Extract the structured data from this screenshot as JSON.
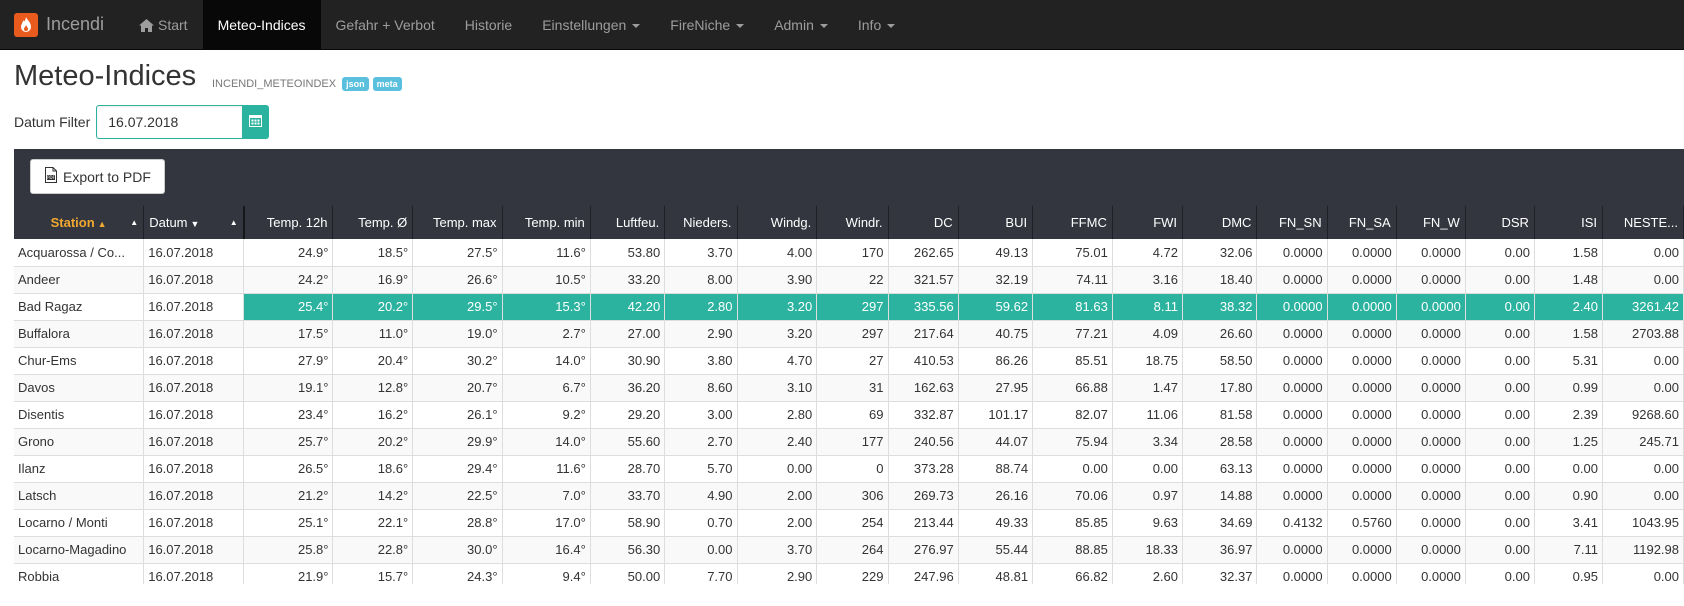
{
  "nav": {
    "brand": "Incendi",
    "items": [
      {
        "label": "Start",
        "active": false,
        "dropdown": false
      },
      {
        "label": "Meteo-Indices",
        "active": true,
        "dropdown": false
      },
      {
        "label": "Gefahr + Verbot",
        "active": false,
        "dropdown": false
      },
      {
        "label": "Historie",
        "active": false,
        "dropdown": false
      },
      {
        "label": "Einstellungen",
        "active": false,
        "dropdown": true
      },
      {
        "label": "FireNiche",
        "active": false,
        "dropdown": true
      },
      {
        "label": "Admin",
        "active": false,
        "dropdown": true
      },
      {
        "label": "Info",
        "active": false,
        "dropdown": true
      }
    ]
  },
  "page": {
    "title": "Meteo-Indices",
    "subtitle": "INCENDI_METEOINDEX",
    "badges": [
      "json",
      "meta"
    ]
  },
  "filter": {
    "label": "Datum Filter",
    "value": "16.07.2018"
  },
  "export_label": "Export to PDF",
  "colors": {
    "navbar": "#222222",
    "accent": "#2bb3a0",
    "header": "#33363e",
    "sort_active": "#f0a830",
    "badge": "#5bc0de"
  },
  "table": {
    "columns": [
      {
        "label": "Station",
        "sort": "▲"
      },
      {
        "label": "Datum",
        "sort": "▼"
      },
      {
        "label": "Temp. 12h"
      },
      {
        "label": "Temp. Ø"
      },
      {
        "label": "Temp. max"
      },
      {
        "label": "Temp. min"
      },
      {
        "label": "Luftfeu."
      },
      {
        "label": "Nieders."
      },
      {
        "label": "Windg."
      },
      {
        "label": "Windr."
      },
      {
        "label": "DC"
      },
      {
        "label": "BUI"
      },
      {
        "label": "FFMC"
      },
      {
        "label": "FWI"
      },
      {
        "label": "DMC"
      },
      {
        "label": "FN_SN"
      },
      {
        "label": "FN_SA"
      },
      {
        "label": "FN_W"
      },
      {
        "label": "DSR"
      },
      {
        "label": "ISI"
      },
      {
        "label": "NESTE..."
      }
    ],
    "highlight_row": 2,
    "rows": [
      [
        "Acquarossa / Co...",
        "16.07.2018",
        "24.9°",
        "18.5°",
        "27.5°",
        "11.6°",
        "53.80",
        "3.70",
        "4.00",
        "170",
        "262.65",
        "49.13",
        "75.01",
        "4.72",
        "32.06",
        "0.0000",
        "0.0000",
        "0.0000",
        "0.00",
        "1.58",
        "0.00"
      ],
      [
        "Andeer",
        "16.07.2018",
        "24.2°",
        "16.9°",
        "26.6°",
        "10.5°",
        "33.20",
        "8.00",
        "3.90",
        "22",
        "321.57",
        "32.19",
        "74.11",
        "3.16",
        "18.40",
        "0.0000",
        "0.0000",
        "0.0000",
        "0.00",
        "1.48",
        "0.00"
      ],
      [
        "Bad Ragaz",
        "16.07.2018",
        "25.4°",
        "20.2°",
        "29.5°",
        "15.3°",
        "42.20",
        "2.80",
        "3.20",
        "297",
        "335.56",
        "59.62",
        "81.63",
        "8.11",
        "38.32",
        "0.0000",
        "0.0000",
        "0.0000",
        "0.00",
        "2.40",
        "3261.42"
      ],
      [
        "Buffalora",
        "16.07.2018",
        "17.5°",
        "11.0°",
        "19.0°",
        "2.7°",
        "27.00",
        "2.90",
        "3.20",
        "297",
        "217.64",
        "40.75",
        "77.21",
        "4.09",
        "26.60",
        "0.0000",
        "0.0000",
        "0.0000",
        "0.00",
        "1.58",
        "2703.88"
      ],
      [
        "Chur-Ems",
        "16.07.2018",
        "27.9°",
        "20.4°",
        "30.2°",
        "14.0°",
        "30.90",
        "3.80",
        "4.70",
        "27",
        "410.53",
        "86.26",
        "85.51",
        "18.75",
        "58.50",
        "0.0000",
        "0.0000",
        "0.0000",
        "0.00",
        "5.31",
        "0.00"
      ],
      [
        "Davos",
        "16.07.2018",
        "19.1°",
        "12.8°",
        "20.7°",
        "6.7°",
        "36.20",
        "8.60",
        "3.10",
        "31",
        "162.63",
        "27.95",
        "66.88",
        "1.47",
        "17.80",
        "0.0000",
        "0.0000",
        "0.0000",
        "0.00",
        "0.99",
        "0.00"
      ],
      [
        "Disentis",
        "16.07.2018",
        "23.4°",
        "16.2°",
        "26.1°",
        "9.2°",
        "29.20",
        "3.00",
        "2.80",
        "69",
        "332.87",
        "101.17",
        "82.07",
        "11.06",
        "81.58",
        "0.0000",
        "0.0000",
        "0.0000",
        "0.00",
        "2.39",
        "9268.60"
      ],
      [
        "Grono",
        "16.07.2018",
        "25.7°",
        "20.2°",
        "29.9°",
        "14.0°",
        "55.60",
        "2.70",
        "2.40",
        "177",
        "240.56",
        "44.07",
        "75.94",
        "3.34",
        "28.58",
        "0.0000",
        "0.0000",
        "0.0000",
        "0.00",
        "1.25",
        "245.71"
      ],
      [
        "Ilanz",
        "16.07.2018",
        "26.5°",
        "18.6°",
        "29.4°",
        "11.6°",
        "28.70",
        "5.70",
        "0.00",
        "0",
        "373.28",
        "88.74",
        "0.00",
        "0.00",
        "63.13",
        "0.0000",
        "0.0000",
        "0.0000",
        "0.00",
        "0.00",
        "0.00"
      ],
      [
        "Latsch",
        "16.07.2018",
        "21.2°",
        "14.2°",
        "22.5°",
        "7.0°",
        "33.70",
        "4.90",
        "2.00",
        "306",
        "269.73",
        "26.16",
        "70.06",
        "0.97",
        "14.88",
        "0.0000",
        "0.0000",
        "0.0000",
        "0.00",
        "0.90",
        "0.00"
      ],
      [
        "Locarno / Monti",
        "16.07.2018",
        "25.1°",
        "22.1°",
        "28.8°",
        "17.0°",
        "58.90",
        "0.70",
        "2.00",
        "254",
        "213.44",
        "49.33",
        "85.85",
        "9.63",
        "34.69",
        "0.4132",
        "0.5760",
        "0.0000",
        "0.00",
        "3.41",
        "1043.95"
      ],
      [
        "Locarno-Magadino",
        "16.07.2018",
        "25.8°",
        "22.8°",
        "30.0°",
        "16.4°",
        "56.30",
        "0.00",
        "3.70",
        "264",
        "276.97",
        "55.44",
        "88.85",
        "18.33",
        "36.97",
        "0.0000",
        "0.0000",
        "0.0000",
        "0.00",
        "7.11",
        "1192.98"
      ],
      [
        "Robbia",
        "16.07.2018",
        "21.9°",
        "15.7°",
        "24.3°",
        "9.4°",
        "50.00",
        "7.70",
        "2.90",
        "229",
        "247.96",
        "48.81",
        "66.82",
        "2.60",
        "32.37",
        "0.0000",
        "0.0000",
        "0.0000",
        "0.00",
        "0.95",
        "0.00"
      ]
    ]
  }
}
